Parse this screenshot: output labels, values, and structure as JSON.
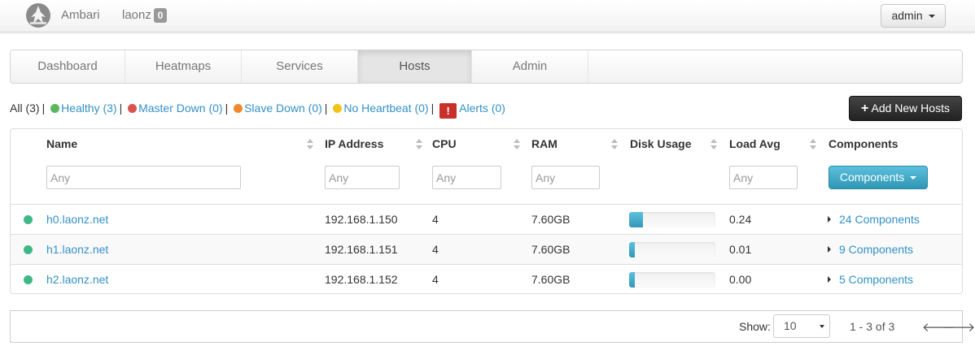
{
  "header": {
    "brand": "Ambari",
    "cluster_name": "laonz",
    "cluster_badge": "0",
    "user_menu": "admin"
  },
  "nav": {
    "tabs": [
      {
        "label": "Dashboard",
        "active": false
      },
      {
        "label": "Heatmaps",
        "active": false
      },
      {
        "label": "Services",
        "active": false
      },
      {
        "label": "Hosts",
        "active": true
      },
      {
        "label": "Admin",
        "active": false
      }
    ]
  },
  "filters": {
    "all": "All (3)",
    "healthy": "Healthy (3)",
    "master_down": "Master Down (0)",
    "slave_down": "Slave Down (0)",
    "no_heartbeat": "No Heartbeat (0)",
    "alert_icon": "!",
    "alerts": "Alerts (0)",
    "separator": "|",
    "colors": {
      "healthy": "#5cb85c",
      "master_down": "#d9534f",
      "slave_down": "#f0882e",
      "no_heartbeat": "#f0c419",
      "alert": "#c9302c"
    }
  },
  "actions": {
    "add_hosts": "Add New Hosts",
    "add_icon": "plus-icon"
  },
  "table": {
    "headers": {
      "name": "Name",
      "ip": "IP Address",
      "cpu": "CPU",
      "ram": "RAM",
      "disk": "Disk Usage",
      "load": "Load Avg",
      "components": "Components"
    },
    "filter_placeholder": "Any",
    "components_button": "Components",
    "rows": [
      {
        "status_color": "#3fb887",
        "name": "h0.laonz.net",
        "ip": "192.168.1.150",
        "cpu": "4",
        "ram": "7.60GB",
        "disk_usage": 0.16,
        "load": "0.24",
        "components": "24 Components"
      },
      {
        "status_color": "#3fb887",
        "name": "h1.laonz.net",
        "ip": "192.168.1.151",
        "cpu": "4",
        "ram": "7.60GB",
        "disk_usage": 0.07,
        "load": "0.01",
        "components": "9 Components"
      },
      {
        "status_color": "#3fb887",
        "name": "h2.laonz.net",
        "ip": "192.168.1.152",
        "cpu": "4",
        "ram": "7.60GB",
        "disk_usage": 0.07,
        "load": "0.00",
        "components": "5 Components"
      }
    ]
  },
  "pagination": {
    "show_label": "Show:",
    "page_size": "10",
    "range": "1 - 3 of 3",
    "prev": "🡐",
    "next": "🡒"
  }
}
